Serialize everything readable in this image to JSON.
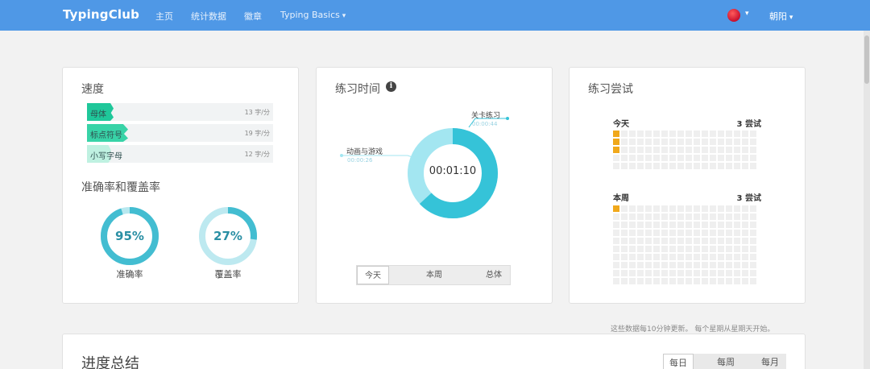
{
  "nav": {
    "brand": "TypingClub",
    "links": [
      "主页",
      "统计数据",
      "徽章"
    ],
    "dropdown": "Typing Basics",
    "user": "朝阳"
  },
  "speed": {
    "title": "速度",
    "rows": [
      {
        "name": "母体",
        "value": "13 字/分",
        "color": "#1fc79a",
        "fill": 0.16
      },
      {
        "name": "标点符号",
        "value": "19 字/分",
        "color": "#38d3a7",
        "fill": 0.22
      },
      {
        "name": "小写字母",
        "value": "12 字/分",
        "color": "#bff1e1",
        "fill": 0.13
      }
    ]
  },
  "accuracy": {
    "title": "准确率和覆盖率",
    "accuracy_pct": "95%",
    "accuracy_value": 0.95,
    "accuracy_label": "准确率",
    "coverage_pct": "27%",
    "coverage_value": 0.27,
    "coverage_label": "覆盖率"
  },
  "practice": {
    "title": "练习时间",
    "total": "00:01:10",
    "segments": [
      {
        "name": "关卡练习",
        "time": "00:00:44",
        "fraction": 0.63,
        "color": "#35c3d8"
      },
      {
        "name": "动画与游戏",
        "time": "00:00:26",
        "fraction": 0.37,
        "color": "#a3e6f1"
      }
    ],
    "tabs": [
      "今天",
      "本周",
      "总体"
    ],
    "active_tab": "今天"
  },
  "attempts": {
    "title": "练习尝试",
    "today_label": "今天",
    "today_count": "3 尝试",
    "week_label": "本周",
    "week_count": "3 尝试"
  },
  "note": "这些数据每10分钟更新。 每个星期从星期天开始。",
  "summary": {
    "title": "进度总结",
    "tabs": [
      "每日",
      "每周",
      "每月"
    ],
    "active_tab": "每日"
  }
}
